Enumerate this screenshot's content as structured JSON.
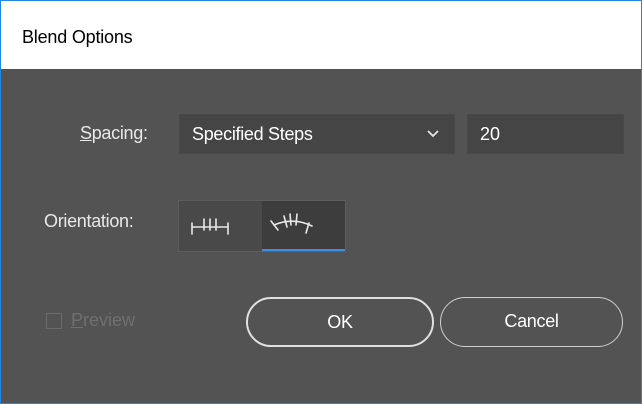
{
  "dialog": {
    "title": "Blend Options"
  },
  "spacing": {
    "label_accel": "S",
    "label_rest": "pacing:",
    "selected": "Specified Steps",
    "steps_value": "20"
  },
  "orientation": {
    "label": "Orientation:",
    "options": [
      {
        "icon": "align-to-page-icon",
        "selected": false
      },
      {
        "icon": "align-to-path-icon",
        "selected": true
      }
    ]
  },
  "preview": {
    "label_accel": "P",
    "label_rest": "review",
    "checked": false,
    "enabled": false
  },
  "buttons": {
    "ok_label": "OK",
    "cancel_label": "Cancel"
  },
  "colors": {
    "dialog_bg": "#535353",
    "field_bg": "#454545",
    "accent": "#3a8ee6",
    "window_border": "#1e88e5"
  }
}
